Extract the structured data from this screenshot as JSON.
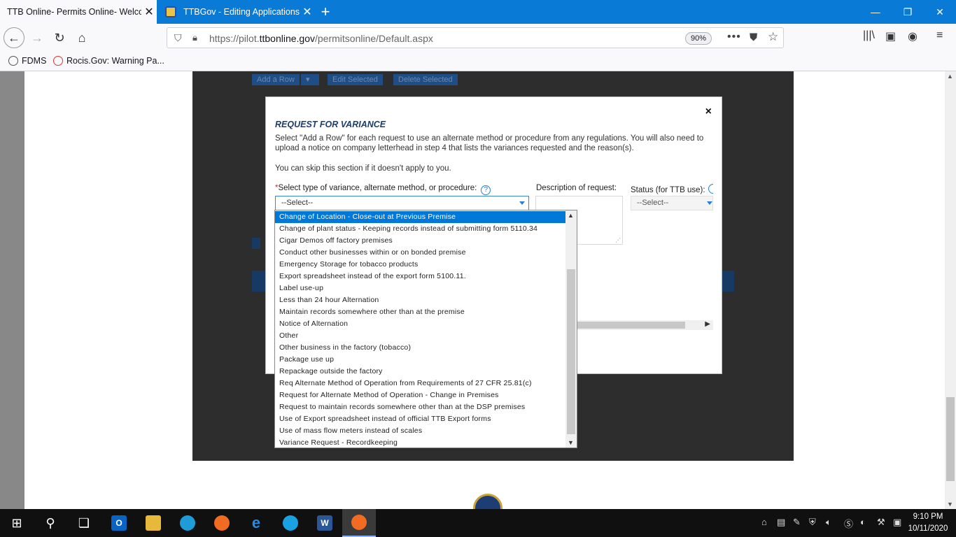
{
  "browser": {
    "tabs": [
      {
        "title": "TTB Online- Permits Online- Welcome"
      },
      {
        "title": "TTBGov - Editing Applications"
      }
    ],
    "url_prefix": "https://pilot.",
    "url_domain": "ttbonline.gov",
    "url_path": "/permitsonline/Default.aspx",
    "zoom": "90%",
    "bookmarks": [
      {
        "label": "FDMS"
      },
      {
        "label": "Rocis.Gov: Warning Pa..."
      }
    ]
  },
  "background_page": {
    "buttons": [
      "Add a Row",
      "Edit Selected",
      "Delete Selected"
    ]
  },
  "modal": {
    "title": "REQUEST FOR VARIANCE",
    "intro_line1": "Select \"Add a Row\" for each request to use an alternate method or procedure from any regulations. You will also need to",
    "intro_line2": "upload a notice on company letterhead in step 4 that lists the variances requested and the reason(s).",
    "skip_text": "You can skip this section if it doesn't apply to you.",
    "variance_label": "Select type of variance, alternate method, or procedure:",
    "variance_selected": "--Select--",
    "description_label": "Description of request:",
    "status_label": "Status (for TTB use):",
    "status_selected": "--Select--",
    "close_symbol": "×"
  },
  "dropdown": {
    "selected_index": 0,
    "options": [
      "Change of Location - Close-out at Previous Premise",
      "Change of plant status - Keeping records instead of submitting form 5110.34",
      "Cigar Demos off factory premises",
      "Conduct other businesses within or on bonded premise",
      "Emergency Storage for tobacco products",
      "Export spreadsheet instead of the export form 5100.11.",
      "Label use-up",
      "Less than 24 hour Alternation",
      "Maintain records somewhere other than at the premise",
      "Notice of Alternation",
      "Other",
      "Other business in the factory (tobacco)",
      "Package use up",
      "Repackage outside the factory",
      "Req Alternate Method of Operation from Requirements of 27 CFR 25.81(c)",
      "Request for Alternate Method of Operation - Change in Premises",
      "Request to maintain records somewhere other than at the DSP premises",
      "Use of Export spreadsheet instead of official TTB Export forms",
      "Use of mass flow meters instead of scales",
      "Variance Request - Recordkeeping"
    ]
  },
  "taskbar": {
    "time": "9:10 PM",
    "date": "10/11/2020"
  },
  "colors": {
    "tabbar": "#0a7ad7",
    "modal_title": "#1b3d6f",
    "selection": "#0078d7"
  }
}
